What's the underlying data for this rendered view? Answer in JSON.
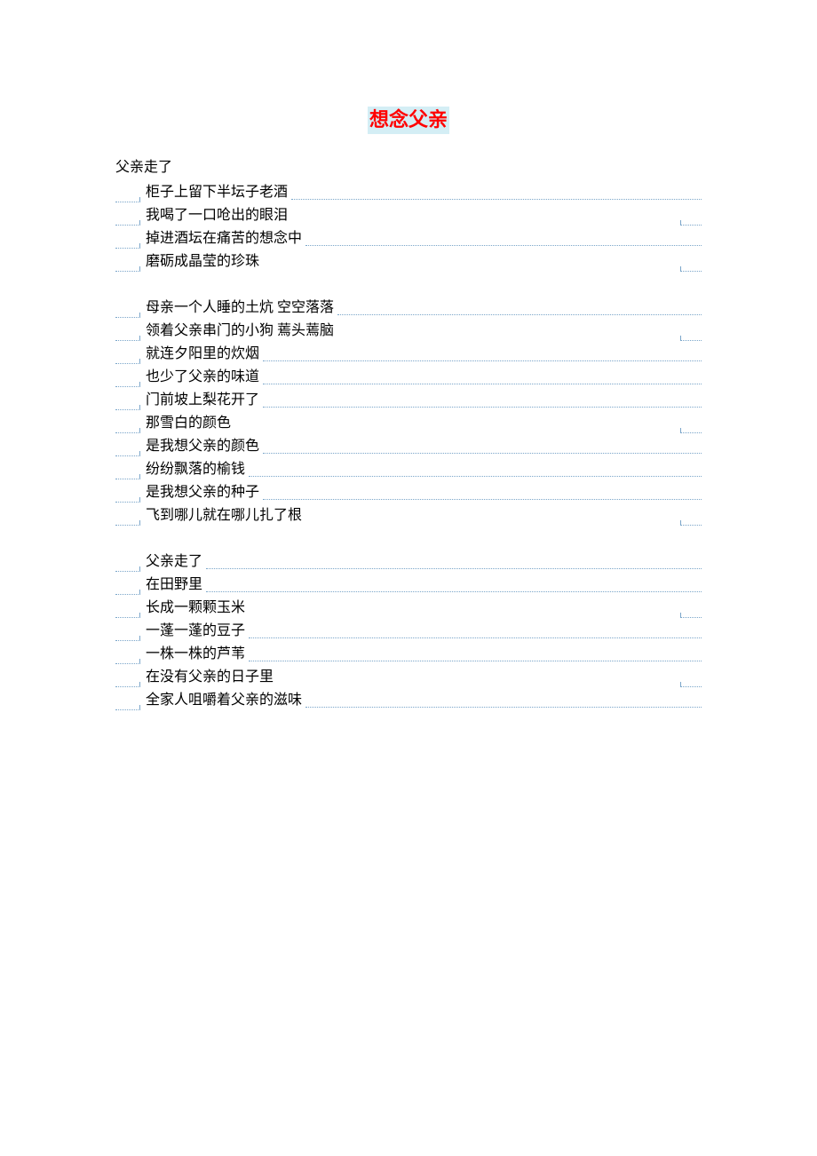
{
  "title": "想念父亲",
  "first_line": "父亲走了",
  "stanzas": [
    {
      "lines": [
        {
          "text": "柜子上留下半坛子老酒",
          "rule": "full"
        },
        {
          "text": "我喝了一口呛出的眼泪",
          "rule": "short"
        },
        {
          "text": "掉进酒坛在痛苦的想念中",
          "rule": "full"
        },
        {
          "text": "磨砺成晶莹的珍珠",
          "rule": "short"
        }
      ]
    },
    {
      "lines": [
        {
          "text": "母亲一个人睡的土炕 空空落落",
          "rule": "full"
        },
        {
          "text": "领着父亲串门的小狗 蔫头蔫脑",
          "rule": "short"
        },
        {
          "text": "就连夕阳里的炊烟",
          "rule": "full"
        },
        {
          "text": "也少了父亲的味道",
          "rule": "full"
        },
        {
          "text": "门前坡上梨花开了",
          "rule": "full"
        },
        {
          "text": "那雪白的颜色",
          "rule": "short"
        },
        {
          "text": "是我想父亲的颜色",
          "rule": "full"
        },
        {
          "text": "纷纷飘落的榆钱",
          "rule": "full"
        },
        {
          "text": "是我想父亲的种子",
          "rule": "full"
        },
        {
          "text": "飞到哪儿就在哪儿扎了根",
          "rule": "short"
        }
      ]
    },
    {
      "lines": [
        {
          "text": "父亲走了",
          "rule": "full"
        },
        {
          "text": "在田野里",
          "rule": "full"
        },
        {
          "text": "长成一颗颗玉米",
          "rule": "short"
        },
        {
          "text": "一蓬一蓬的豆子",
          "rule": "full"
        },
        {
          "text": "一株一株的芦苇",
          "rule": "full"
        },
        {
          "text": "在没有父亲的日子里",
          "rule": "short"
        },
        {
          "text": "全家人咀嚼着父亲的滋味",
          "rule": "full"
        }
      ]
    }
  ]
}
